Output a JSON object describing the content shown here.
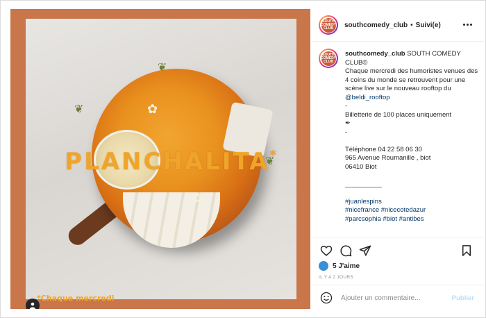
{
  "post": {
    "username": "southcomedy_club",
    "follow_status": "Suivi(e)",
    "separator": "•",
    "avatar_text": "SOUTH COMEDY CLUB",
    "media": {
      "overlay_title": "PLANCHALITA",
      "overlay_star": "*",
      "overlay_caption": "*Chaque mercredi"
    },
    "caption": {
      "username": "southcomedy_club",
      "lines": [
        "SOUTH COMEDY CLUB©",
        "Chaque mercredi des humoristes venues des 4 coins du monde se retrouvent pour une scène live sur le nouveau rooftop du",
        "@beldi_rooftop",
        "-",
        "Billetterie de 100 places uniquement",
        "✒",
        "-",
        "Téléphone 04 22 58 06 30",
        "965 Avenue Roumanille , biot",
        "06410 Biot",
        "__________",
        "#juanlespins",
        "#nicefrance #nicecotedazur",
        "#parcsophia #biot #antibes"
      ]
    },
    "likes": "5 J'aime",
    "timestamp": "IL Y A 2 JOURS",
    "comment": {
      "placeholder": "Ajouter un commentaire...",
      "publish_label": "Publier"
    },
    "icons": [
      "heart-icon",
      "comment-icon",
      "share-icon",
      "bookmark-icon",
      "emoji-icon",
      "more-icon",
      "user-tag-icon"
    ]
  }
}
